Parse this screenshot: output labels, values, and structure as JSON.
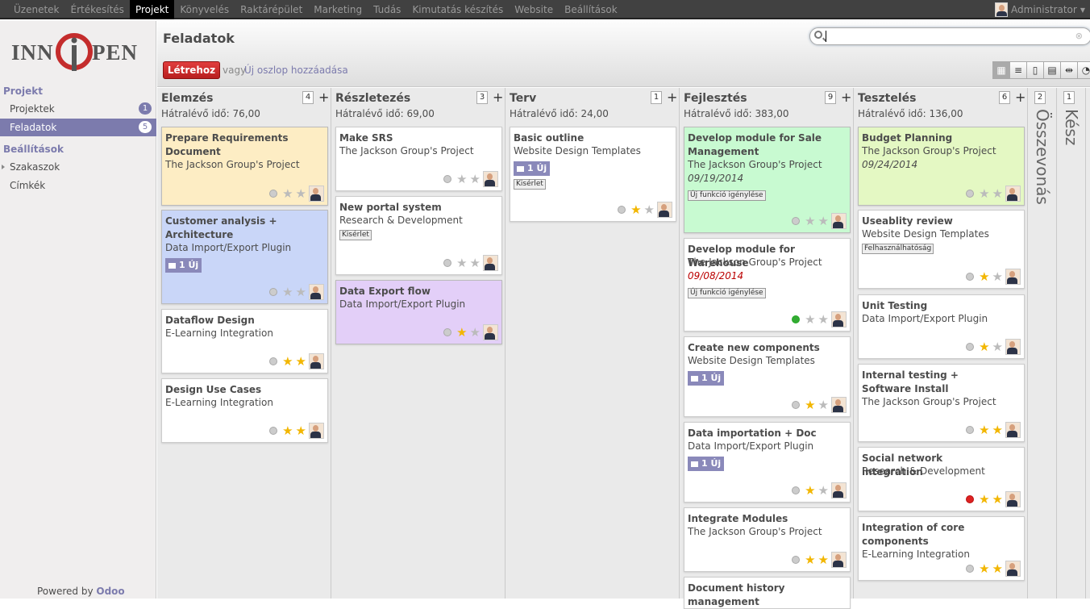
{
  "topbar": {
    "menu": [
      "Üzenetek",
      "Értékesítés",
      "Projekt",
      "Könyvelés",
      "Raktárépület",
      "Marketing",
      "Tudás",
      "Kimutatás készítés",
      "Website",
      "Beállítások"
    ],
    "active": 2,
    "user": "Administrator"
  },
  "sidebar": {
    "logo_text": "INNOPEN",
    "section1": "Projekt",
    "items1": [
      {
        "label": "Projektek",
        "badge": "1"
      },
      {
        "label": "Feladatok",
        "badge": "5"
      }
    ],
    "section2": "Beállítások",
    "items2": [
      {
        "label": "Szakaszok"
      },
      {
        "label": "Címkék"
      }
    ],
    "powered_prefix": "Powered by",
    "powered_brand": "Odoo"
  },
  "header": {
    "title": "Feladatok",
    "create": "Létrehoz",
    "or": "vagy",
    "add_column": "Új oszlop hozzáadása",
    "search_placeholder": ""
  },
  "colors": {
    "accent": "#7c7bad",
    "create": "#c52828"
  },
  "columns": [
    {
      "title": "Elemzés",
      "count": "4",
      "summary": "Hátralévő idő: 76,00",
      "cards": [
        {
          "name": "Prepare Requirements Document",
          "project": "The Jackson Group's Project",
          "color": "#fdedc4",
          "stars": 0,
          "status": "grey"
        },
        {
          "name": "Customer analysis + Architecture",
          "project": "Data Import/Export Plugin",
          "color": "#c9d6f8",
          "msg": "1 Új",
          "stars": 0,
          "status": "grey"
        },
        {
          "name": "Dataflow Design",
          "project": "E-Learning Integration",
          "color": "#ffffff",
          "stars": 2,
          "status": "grey"
        },
        {
          "name": "Design Use Cases",
          "project": "E-Learning Integration",
          "color": "#ffffff",
          "stars": 2,
          "status": "grey"
        }
      ]
    },
    {
      "title": "Részletezés",
      "count": "3",
      "summary": "Hátralévő idő: 69,00",
      "cards": [
        {
          "name": "Make SRS",
          "project": "The Jackson Group's Project",
          "color": "#ffffff",
          "stars": 0,
          "status": "grey"
        },
        {
          "name": "New portal system",
          "project": "Research & Development",
          "color": "#ffffff",
          "tag": "Kisérlet",
          "stars": 0,
          "status": "grey"
        },
        {
          "name": "Data Export flow",
          "project": "Data Import/Export Plugin",
          "color": "#e3cff8",
          "stars": 1,
          "status": "grey"
        }
      ]
    },
    {
      "title": "Terv",
      "count": "1",
      "summary": "Hátralévő idő: 24,00",
      "cards": [
        {
          "name": "Basic outline",
          "project": "Website Design Templates",
          "color": "#ffffff",
          "msg": "1 Új",
          "tag": "Kisérlet",
          "stars": 1,
          "status": "grey"
        }
      ]
    },
    {
      "title": "Fejlesztés",
      "count": "9",
      "summary": "Hátralévő idő: 383,00",
      "cards": [
        {
          "name": "Develop module for Sale Management",
          "project": "The Jackson Group's Project",
          "date": "09/19/2014",
          "tag": "Új funkció igénylése",
          "color": "#c8fad1",
          "stars": 0,
          "status": "grey"
        },
        {
          "name": "Develop module for Warehouse",
          "project": "The Jackson Group's Project",
          "date": "09/08/2014",
          "late": true,
          "tag": "Új funkció igénylése",
          "color": "#ffffff",
          "stars": 0,
          "status": "green"
        },
        {
          "name": "Create new components",
          "project": "Website Design Templates",
          "msg": "1 Új",
          "color": "#ffffff",
          "stars": 1,
          "status": "grey"
        },
        {
          "name": "Data importation + Doc",
          "project": "Data Import/Export Plugin",
          "msg": "1 Új",
          "color": "#ffffff",
          "stars": 1,
          "status": "grey"
        },
        {
          "name": "Integrate Modules",
          "project": "The Jackson Group's Project",
          "color": "#ffffff",
          "stars": 2,
          "status": "grey"
        },
        {
          "name": "Document history management",
          "project": "",
          "color": "#ffffff",
          "stars": -1,
          "status": "none"
        }
      ]
    },
    {
      "title": "Tesztelés",
      "count": "6",
      "summary": "Hátralévő idő: 136,00",
      "cards": [
        {
          "name": "Budget Planning",
          "project": "The Jackson Group's Project",
          "date": "09/24/2014",
          "color": "#e4f8c3",
          "stars": 0,
          "status": "grey"
        },
        {
          "name": "Useablity review",
          "project": "Website Design Templates",
          "tag": "Felhasználhatóság",
          "color": "#ffffff",
          "stars": 1,
          "status": "grey"
        },
        {
          "name": "Unit Testing",
          "project": "Data Import/Export Plugin",
          "color": "#ffffff",
          "stars": 1,
          "status": "grey"
        },
        {
          "name": "Internal testing + Software Install",
          "project": "The Jackson Group's Project",
          "color": "#ffffff",
          "stars": 2,
          "status": "grey"
        },
        {
          "name": "Social network integration",
          "project": "Research & Development",
          "color": "#ffffff",
          "stars": 2,
          "status": "red"
        },
        {
          "name": "Integration of core components",
          "project": "E-Learning Integration",
          "color": "#ffffff",
          "stars": 2,
          "status": "grey"
        }
      ]
    }
  ],
  "folded": [
    {
      "title": "Összevonás",
      "count": "2"
    },
    {
      "title": "Kész",
      "count": "1"
    }
  ],
  "view_icons": [
    "kanban-view-icon",
    "list-view-icon",
    "form-view-icon",
    "calendar-view-icon",
    "gantt-view-icon",
    "graph-view-icon"
  ]
}
